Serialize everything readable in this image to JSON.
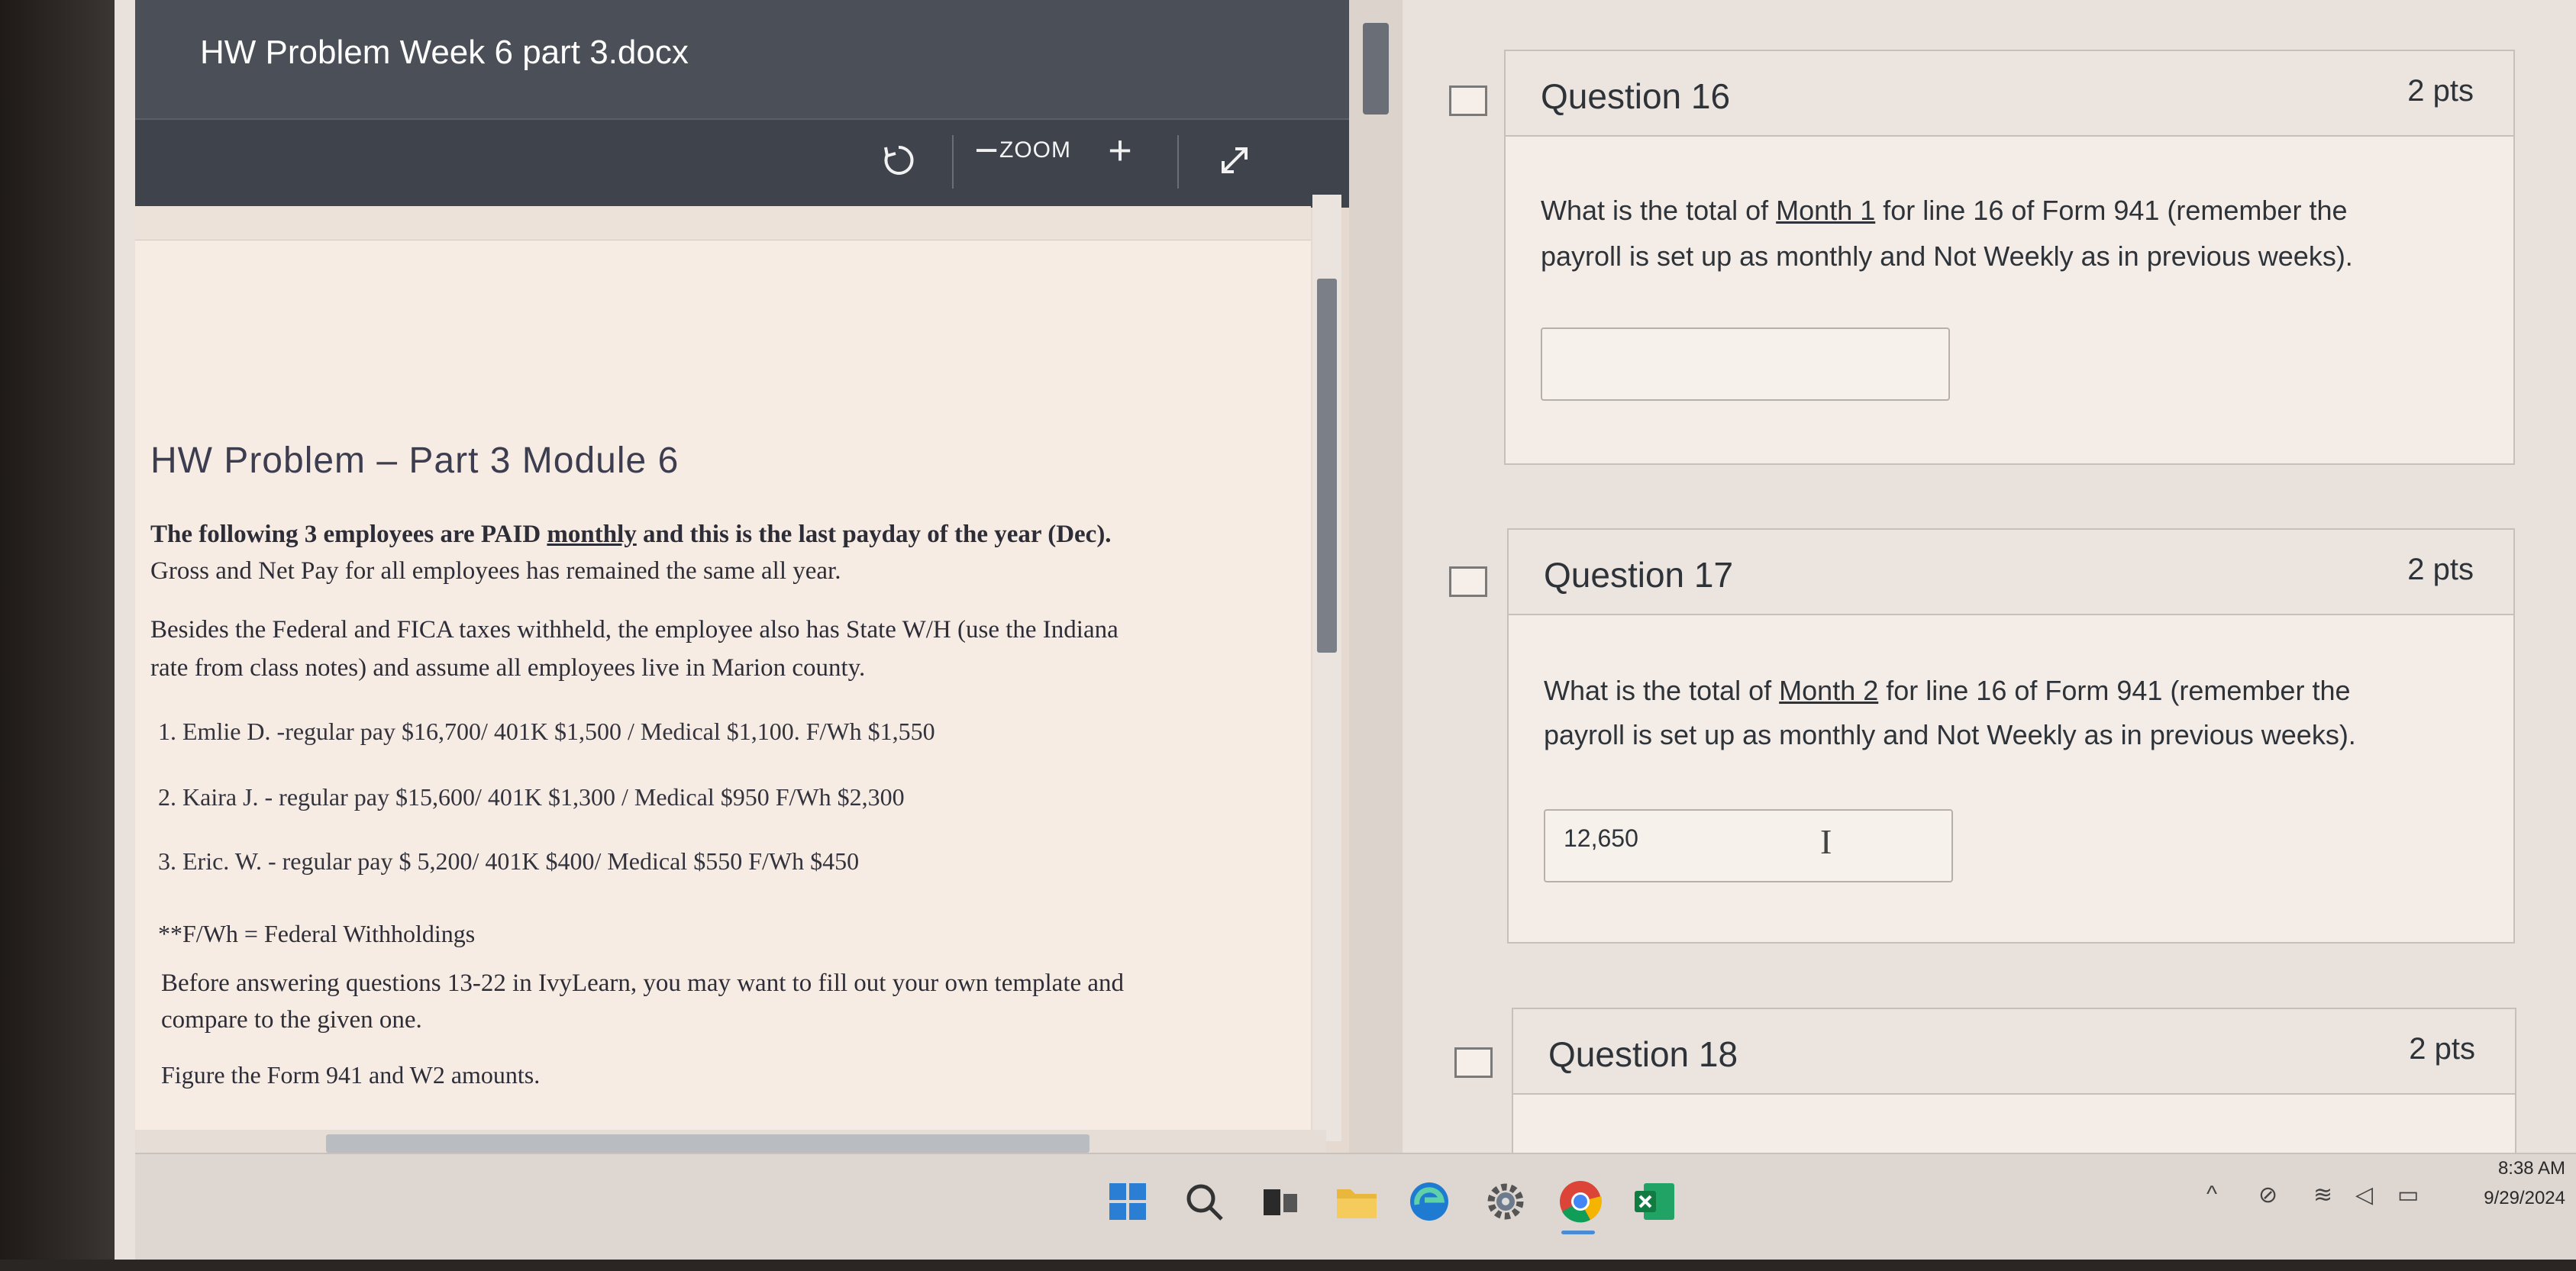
{
  "viewer": {
    "doc_title": "HW Problem Week 6 part 3.docx",
    "toolbar": {
      "rotate_icon": "rotate-icon",
      "zoom_out": "−",
      "zoom_label": "ZOOM",
      "zoom_in": "+",
      "fullscreen_icon": "expand-icon"
    }
  },
  "document": {
    "heading": "HW Problem – Part 3  Module 6",
    "intro_line1_a": "The following 3 employees are PAID ",
    "intro_line1_u": "monthly",
    "intro_line1_b": " and this is the last payday of the year (Dec).",
    "intro_line2": "Gross and Net Pay for all employees has remained the same all year.",
    "besides_line1": "Besides the Federal and FICA taxes withheld, the employee also has State W/H (use the Indiana",
    "besides_line2": "rate from class notes) and assume all employees live in Marion county.",
    "employees": [
      "1.  Emlie D.  -regular pay $16,700/   401K  $1,500 / Medical $1,100.  F/Wh $1,550",
      "2.  Kaira J.  -  regular pay   $15,600/   401K  $1,300 / Medical $950    F/Wh  $2,300",
      "3.  Eric. W.   - regular pay   $  5,200/   401K  $400/  Medical $550      F/Wh   $450"
    ],
    "footnote": "**F/Wh = Federal Withholdings",
    "before_line1": "Before answering questions 13-22 in IvyLearn, you may want to fill out your own template and",
    "before_line2": "compare to the given one.",
    "figure_line": "Figure the Form 941 and W2 amounts."
  },
  "questions": [
    {
      "title": "Question 16",
      "points": "2 pts",
      "line1_a": "What is the total of ",
      "line1_u": "Month 1",
      "line1_b": " for line 16 of Form 941  (remember the",
      "line2": "payroll is set up as monthly and Not Weekly as in previous weeks).",
      "answer": ""
    },
    {
      "title": "Question 17",
      "points": "2 pts",
      "line1_a": "What is the total of ",
      "line1_u": "Month  2",
      "line1_b": " for line 16 of Form 941  (remember the",
      "line2": "payroll is set up as monthly and Not Weekly as in previous weeks).",
      "answer": "12,650"
    },
    {
      "title": "Question 18",
      "points": "2 pts"
    }
  ],
  "taskbar": {
    "apps": [
      "windows-start-icon",
      "search-icon",
      "task-view-icon",
      "file-explorer-icon",
      "edge-icon",
      "settings-icon",
      "chrome-icon",
      "excel-icon"
    ],
    "tray_icons": [
      "chevron-up-icon",
      "network-off-icon",
      "wifi-icon",
      "volume-icon",
      "battery-icon"
    ],
    "time": "8:38 AM",
    "date": "9/29/2024"
  },
  "colors": {
    "viewer_bar": "#4a4f58",
    "page_bg": "#f6ece4",
    "card_bg": "#f4ece6"
  }
}
